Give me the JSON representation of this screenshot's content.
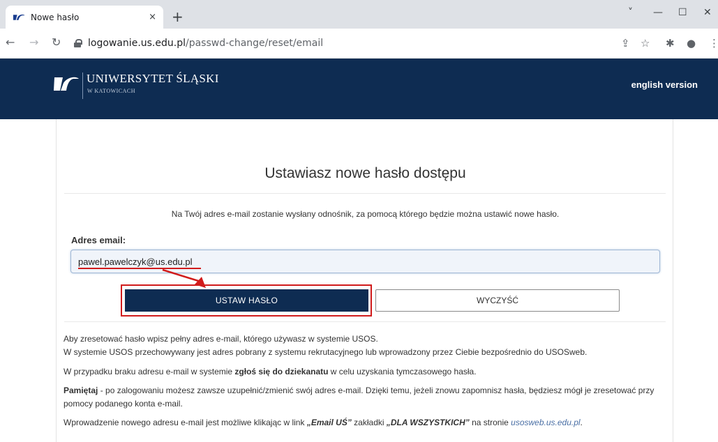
{
  "browser": {
    "tab_title": "Nowe hasło",
    "tab_close": "×",
    "new_tab": "+",
    "url_host": "logowanie.us.edu.pl",
    "url_path": "/passwd-change/reset/email",
    "window_controls": [
      "˅",
      "—",
      "☐",
      "✕"
    ]
  },
  "header": {
    "logo_name": "UNIWERSYTET ŚLĄSKI",
    "logo_sub": "W KATOWICACH",
    "language_link": "english version"
  },
  "form": {
    "title": "Ustawiasz nowe hasło dostępu",
    "intro": "Na Twój adres e-mail zostanie wysłany odnośnik, za pomocą którego będzie można ustawić nowe hasło.",
    "email_label": "Adres email:",
    "email_value": "pawel.pawelczyk@us.edu.pl",
    "submit_label": "USTAW HASŁO",
    "clear_label": "WYCZYŚĆ"
  },
  "info": {
    "p1_line1": "Aby zresetować hasło wpisz pełny adres e-mail, którego używasz w systemie USOS.",
    "p1_line2": "W systemie USOS przechowywany jest adres pobrany z systemu rekrutacyjnego lub wprowadzony przez Ciebie bezpośrednio do USOSweb.",
    "p2_pre": "W przypadku braku adresu e-mail w systemie ",
    "p2_bold": "zgłoś się do dziekanatu",
    "p2_post": " w celu uzyskania tymczasowego hasła.",
    "p3_bold": "Pamiętaj",
    "p3_text": " - po zalogowaniu możesz zawsze uzupełnić/zmienić swój adres e-mail. Dzięki temu, jeżeli znowu zapomnisz hasła, będziesz mógł je zresetować przy pomocy podanego konta e-mail.",
    "p4_pre": "Wprowadzenie nowego adresu e-mail jest możliwe klikając w link ",
    "p4_em1": "„Email UŚ”",
    "p4_mid": " zakładki ",
    "p4_em2": "„DLA WSZYSTKICH”",
    "p4_mid2": " na stronie ",
    "p4_link": "usosweb.us.edu.pl",
    "p4_end": "."
  },
  "colors": {
    "brand_navy": "#0e2c52",
    "highlight_red": "#d11b1b"
  }
}
